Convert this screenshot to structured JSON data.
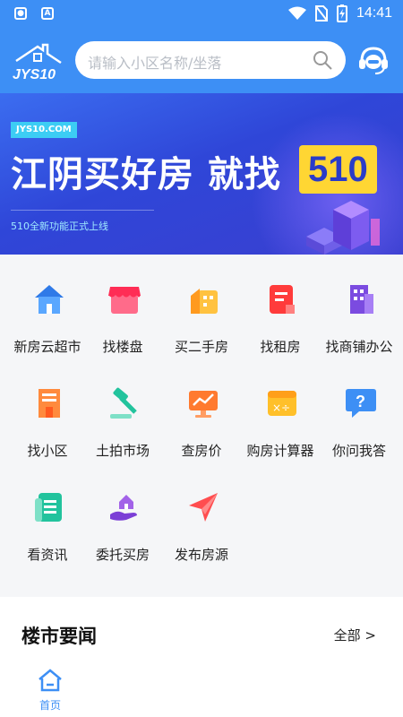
{
  "status_bar": {
    "time": "14:41"
  },
  "header": {
    "search_placeholder": "请输入小区名称/坐落"
  },
  "banner": {
    "domain": "JYS10.COM",
    "headline": "江阴买好房 就找",
    "number": "510",
    "subline": "510全新功能正式上线"
  },
  "grid": {
    "items": [
      {
        "label": "新房云超市",
        "icon": "house-icon",
        "color": "#3d8ff5"
      },
      {
        "label": "找楼盘",
        "icon": "store-icon",
        "color": "#ff4d6d"
      },
      {
        "label": "买二手房",
        "icon": "building-icon",
        "color": "#ffb12a"
      },
      {
        "label": "找租房",
        "icon": "document-icon",
        "color": "#ff4d4f"
      },
      {
        "label": "找商铺办公",
        "icon": "office-icon",
        "color": "#8e5ae8"
      },
      {
        "label": "找小区",
        "icon": "community-icon",
        "color": "#ff7a2f"
      },
      {
        "label": "土拍市场",
        "icon": "gavel-icon",
        "color": "#2ec9a7"
      },
      {
        "label": "查房价",
        "icon": "chart-monitor-icon",
        "color": "#ff7a2f"
      },
      {
        "label": "购房计算器",
        "icon": "calculator-icon",
        "color": "#ffc02a"
      },
      {
        "label": "你问我答",
        "icon": "question-icon",
        "color": "#3d8ff5"
      },
      {
        "label": "看资讯",
        "icon": "news-icon",
        "color": "#2ec9a7"
      },
      {
        "label": "委托买房",
        "icon": "hand-house-icon",
        "color": "#8e5ae8"
      },
      {
        "label": "发布房源",
        "icon": "paper-plane-icon",
        "color": "#ff4d4f"
      }
    ]
  },
  "news": {
    "title": "楼市要闻",
    "more": "全部 >"
  },
  "tabbar": {
    "home_label": "首页"
  },
  "colors": {
    "primary": "#3d8ff5",
    "banner": "#2f46d8",
    "accent": "#ffd633"
  }
}
